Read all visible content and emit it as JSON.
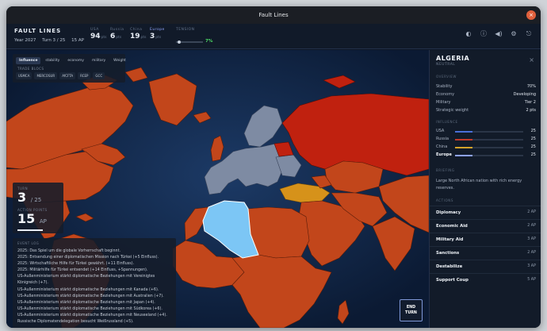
{
  "window": {
    "title": "Fault Lines",
    "close_glyph": "×"
  },
  "header": {
    "game_name": "FAULT LINES",
    "year": "Year 2027",
    "turn": "Turn 3 / 25",
    "ap": "15 AP",
    "stats": [
      {
        "label": "USA",
        "value": "94",
        "unit": "pts"
      },
      {
        "label": "Russia",
        "value": "6",
        "unit": "pts"
      },
      {
        "label": "China",
        "value": "19",
        "unit": "pts"
      },
      {
        "label": "Europe",
        "value": "3",
        "unit": "pts"
      }
    ],
    "tension_label": "TENSION",
    "tension_value": "7%",
    "tension_fraction": 0.07,
    "icons": [
      "moon-icon",
      "info-icon",
      "sound-icon",
      "settings-icon",
      "exit-icon"
    ]
  },
  "map_controls": {
    "modes": [
      "Influence",
      "stability",
      "economy",
      "military",
      "Weight"
    ],
    "active_mode": "Influence",
    "blocs_title": "TRADE BLOCS",
    "blocs": [
      "USMCA",
      "MERCOSUR",
      "AfCFTA",
      "RCEP",
      "GCC"
    ]
  },
  "turn_panel": {
    "turn_label": "TURN",
    "turn_value": "3",
    "turn_total": "/ 25",
    "ap_label": "ACTION POINTS",
    "ap_value": "15",
    "ap_unit": "AP"
  },
  "event_log": {
    "title": "EVENT LOG",
    "lines": [
      "2025: Das Spiel um die globale Vorherrschaft beginnt.",
      "2025: Entsendung einer diplomatischen Mission nach Türkei (+5 Einfluss).",
      "2025: Wirtschaftliche Hilfe für Türkei gewährt. (+11 Einfluss).",
      "2025: Militärhilfe für Türkei entsendet (+14 Einfluss, +Spannungen).",
      "US-Außenministerium stärkt diplomatische Beziehungen mit Vereinigtes",
      "Königreich (+7).",
      "US-Außenministerium stärkt diplomatische Beziehungen mit Kanada (+6).",
      "US-Außenministerium stärkt diplomatische Beziehungen mit Australien (+7).",
      "US-Außenministerium stärkt diplomatische Beziehungen mit Japan (+4).",
      "US-Außenministerium stärkt diplomatische Beziehungen mit Südkorea (+6).",
      "US-Außenministerium stärkt diplomatische Beziehungen mit Neuseeland (+4).",
      "Russische Diplomatendelegation besucht Weißrussland (+5)."
    ]
  },
  "end_turn": {
    "line1": "END",
    "line2": "TURN"
  },
  "sidebar": {
    "country": "ALGERIA",
    "status": "NEUTRAL",
    "overview_title": "OVERVIEW",
    "overview": [
      {
        "k": "Stability",
        "v": "70%"
      },
      {
        "k": "Economy",
        "v": "Developing"
      },
      {
        "k": "Military",
        "v": "Tier 2"
      },
      {
        "k": "Strategic weight",
        "v": "2 pts"
      }
    ],
    "influence_title": "INFLUENCE",
    "influence": [
      {
        "name": "USA",
        "value": "25",
        "fraction": 0.25,
        "color": "#4a6fd8"
      },
      {
        "name": "Russia",
        "value": "25",
        "fraction": 0.25,
        "color": "#c0392b"
      },
      {
        "name": "China",
        "value": "25",
        "fraction": 0.25,
        "color": "#d4a32a"
      },
      {
        "name": "Europe",
        "value": "25",
        "fraction": 0.25,
        "color": "#8da2ff"
      }
    ],
    "briefing_title": "BRIEFING",
    "description": "Large North African nation with rich energy reserves.",
    "actions_title": "ACTIONS",
    "actions": [
      {
        "name": "Diplomacy",
        "cost": "2 AP"
      },
      {
        "name": "Economic Aid",
        "cost": "2 AP"
      },
      {
        "name": "Military Aid",
        "cost": "3 AP"
      },
      {
        "name": "Sanctions",
        "cost": "2 AP"
      },
      {
        "name": "Destabilize",
        "cost": "3 AP"
      },
      {
        "name": "Support Coup",
        "cost": "5 AP"
      }
    ]
  },
  "colors": {
    "usa": "#c2461b",
    "russia": "#c0210f",
    "europe": "#7e8ba3",
    "selected": "#7cc6f5",
    "turkey": "#d6921a",
    "ocean": "#0e2040"
  }
}
